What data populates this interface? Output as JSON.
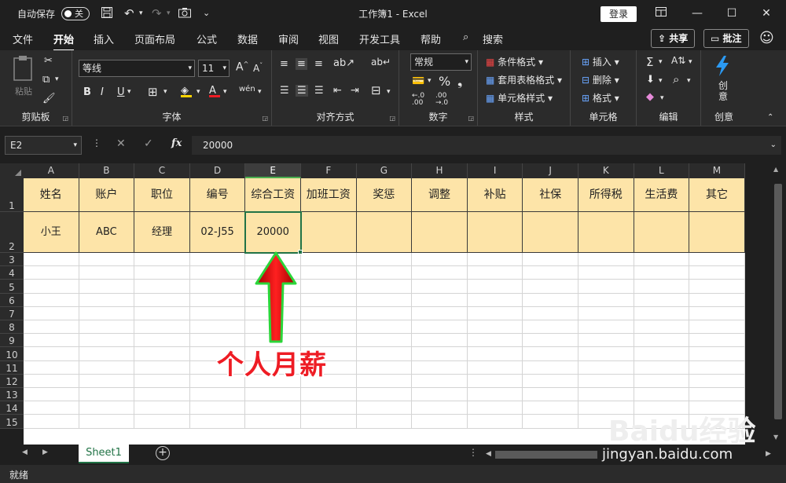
{
  "titlebar": {
    "autosave_label": "自动保存",
    "autosave_state": "关",
    "doc_title": "工作簿1  -  Excel",
    "login_label": "登录"
  },
  "menu": {
    "items": [
      "文件",
      "开始",
      "插入",
      "页面布局",
      "公式",
      "数据",
      "审阅",
      "视图",
      "开发工具",
      "帮助"
    ],
    "active": "开始",
    "search_label": "搜索",
    "share_label": "共享",
    "comment_label": "批注"
  },
  "ribbon": {
    "clipboard": {
      "paste_label": "粘贴",
      "group_label": "剪贴板"
    },
    "font": {
      "font_name": "等线",
      "font_size": "11",
      "group_label": "字体",
      "bold": "B",
      "italic": "I",
      "underline": "U",
      "wen": "wén"
    },
    "alignment": {
      "group_label": "对齐方式"
    },
    "number": {
      "format": "常规",
      "percent": "%",
      "group_label": "数字"
    },
    "styles": {
      "conditional": "条件格式",
      "table": "套用表格格式",
      "cell_styles": "单元格样式",
      "group_label": "样式"
    },
    "cells": {
      "insert": "插入",
      "delete": "删除",
      "format": "格式",
      "group_label": "单元格"
    },
    "editing": {
      "group_label": "编辑"
    },
    "creative": {
      "label_1": "创",
      "label_2": "意",
      "group_label": "创意"
    }
  },
  "formula_bar": {
    "name_box": "E2",
    "value": "20000",
    "fx": "fx"
  },
  "sheet": {
    "columns": [
      "A",
      "B",
      "C",
      "D",
      "E",
      "F",
      "G",
      "H",
      "I",
      "J",
      "K",
      "L",
      "M"
    ],
    "selected_column": "E",
    "rows": [
      "1",
      "2",
      "3",
      "4",
      "5",
      "6",
      "7",
      "8",
      "9",
      "10",
      "11",
      "12",
      "13",
      "14",
      "15"
    ],
    "header_row": [
      "姓名",
      "账户",
      "职位",
      "编号",
      "综合工资",
      "加班工资",
      "奖惩",
      "调整",
      "补贴",
      "社保",
      "所得税",
      "生活费",
      "其它"
    ],
    "data_row": [
      "小王",
      "ABC",
      "经理",
      "02-J55",
      "20000",
      "",
      "",
      "",
      "",
      "",
      "",
      "",
      ""
    ],
    "active_cell": "E2",
    "fill_color": "#fde4a8"
  },
  "annotation": {
    "text": "个人月薪",
    "color": "#ee1c24",
    "arrow_color": "#ee1c24"
  },
  "tabs": {
    "sheets": [
      "Sheet1"
    ],
    "active": "Sheet1"
  },
  "status": {
    "text": "就绪"
  },
  "watermark": {
    "brand": "Baidu经验",
    "url": "jingyan.baidu.com"
  },
  "colors": {
    "excel_green": "#217346",
    "dark_bg": "#1f1f1f",
    "ribbon_bg": "#2b2b2b"
  }
}
